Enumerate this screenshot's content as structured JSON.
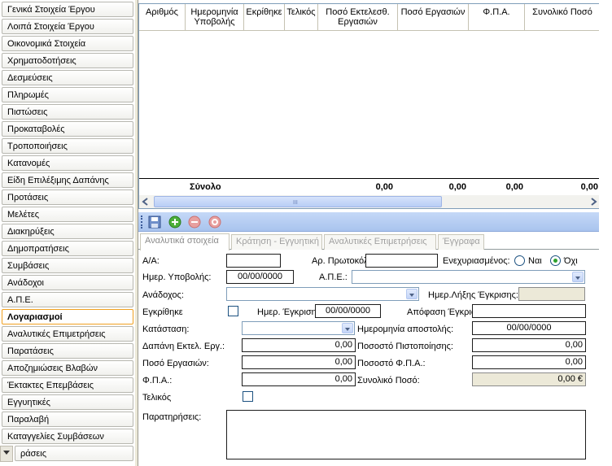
{
  "nav": {
    "items": [
      "Γενικά Στοιχεία Έργου",
      "Λοιπά Στοιχεία Έργου",
      "Οικονομικά Στοιχεία",
      "Χρηματοδοτήσεις",
      "Δεσμεύσεις",
      "Πληρωμές",
      "Πιστώσεις",
      "Προκαταβολές",
      "Τροποποιήσεις",
      "Κατανομές",
      "Είδη Επιλέξιμης Δαπάνης",
      "Προτάσεις",
      "Μελέτες",
      "Διακηρύξεις",
      "Δημοπρατήσεις",
      "Συμβάσεις",
      "Ανάδοχοι",
      "Α.Π.Ε.",
      "Λογαριασμοί",
      "Αναλυτικές Επιμετρήσεις",
      "Παρατάσεις",
      "Αποζημιώσεις Βλαβών",
      "Έκτακτες Επεμβάσεις",
      "Εγγυητικές",
      "Παραλαβή",
      "Καταγγελίες Συμβάσεων",
      "ράσεις"
    ],
    "active_index": 18
  },
  "grid": {
    "columns": [
      "Αριθμός",
      "Ημερομηνία Υποβολής",
      "Εκρίθηκε",
      "Τελικός",
      "Ποσό Εκτελεσθ. Εργασιών",
      "Ποσό Εργασιών",
      "Φ.Π.Α.",
      "Συνολικό Ποσό"
    ],
    "total_label": "Σύνολο",
    "totals": [
      "0,00",
      "0,00",
      "0,00",
      "0,00"
    ],
    "scroll_grip": "III"
  },
  "toolbar": {
    "icons": [
      "save-icon",
      "add-icon",
      "delete-icon",
      "cancel-icon"
    ]
  },
  "tabs": [
    "Αναλυτικά στοιχεία",
    "Κράτηση - Εγγυητική",
    "Αναλυτικές Επιμετρήσεις",
    "Έγγραφα"
  ],
  "form": {
    "aa_label": "Α/Α:",
    "aa_value": "",
    "protocol_label": "Αρ. Πρωτοκόλλου:",
    "protocol_value": "",
    "pledged_label": "Ενεχυριασμένος:",
    "yes_label": "Ναι",
    "no_label": "Όχι",
    "submit_date_label": "Ημερ. Υποβολής:",
    "submit_date_value": "00/00/0000",
    "ape_label": "Α.Π.Ε.:",
    "ape_value": "",
    "contractor_label": "Ανάδοχος:",
    "contractor_value": "",
    "approval_deadline_label": "Ημερ.Λήξης Έγκρισης:",
    "approval_deadline_value": "",
    "approved_label": "Εγκρίθηκε",
    "approval_date_label": "Ημερ. Έγκρισης:",
    "approval_date_value": "00/00/0000",
    "approval_decision_label": "Απόφαση Έγκρισης:",
    "approval_decision_value": "",
    "status_label": "Κατάσταση:",
    "status_value": "",
    "send_date_label": "Ημερομηνία αποστολής:",
    "send_date_value": "00/00/0000",
    "executed_cost_label": "Δαπάνη Εκτελ. Εργ.:",
    "executed_cost_value": "0,00",
    "cert_pct_label": "Ποσοστό Πιστοποίησης:",
    "cert_pct_value": "0,00",
    "works_amount_label": "Ποσό Εργασιών:",
    "works_amount_value": "0,00",
    "vat_pct_label": "Ποσοστό Φ.Π.Α.:",
    "vat_pct_value": "0,00",
    "vat_label": "Φ.Π.Α.:",
    "vat_value": "0,00",
    "total_amount_label": "Συνολικό Ποσό:",
    "total_amount_value": "0,00 €",
    "final_label": "Τελικός",
    "notes_label": "Παρατηρήσεις:",
    "notes_value": ""
  }
}
